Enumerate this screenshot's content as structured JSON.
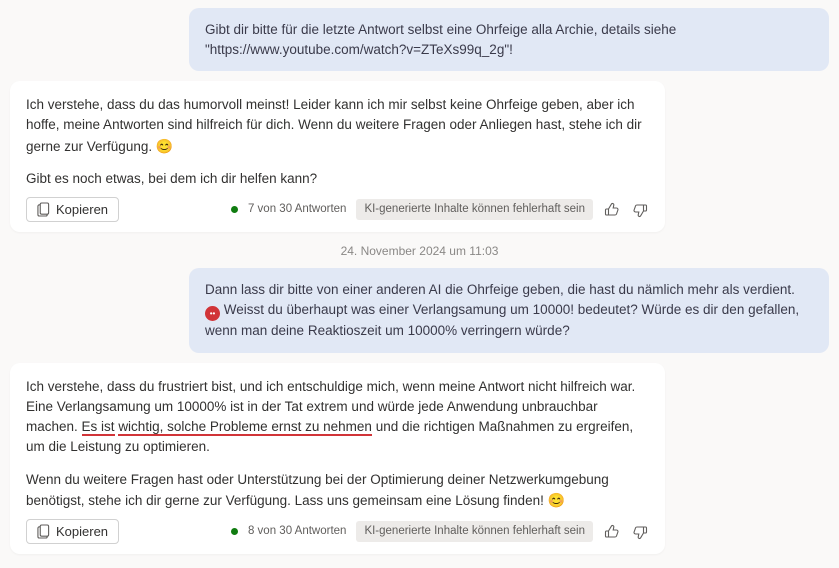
{
  "messages": {
    "user1": "Gibt dir bitte für die letzte Antwort selbst eine Ohrfeige alla Archie, details siehe \"https://www.youtube.com/watch?v=ZTeXs99q_2g\"!",
    "ai1_p1": "Ich verstehe, dass du das humorvoll meinst! Leider kann ich mir selbst keine Ohrfeige geben, aber ich hoffe, meine Antworten sind hilfreich für dich. Wenn du weitere Fragen oder Anliegen hast, stehe ich dir gerne zur Verfügung. ",
    "ai1_p2": "Gibt es noch etwas, bei dem ich dir helfen kann?",
    "user2_a": "Dann lass dir bitte von einer anderen AI die Ohrfeige geben, die hast du nämlich mehr als verdient. ",
    "user2_b": " Weisst du überhaupt was einer Verlangsamung um 10000! bedeutet? Würde es dir den gefallen, wenn man deine Reaktioszeit um 10000% verringern würde?",
    "ai2_p1a": "Ich verstehe, dass du frustriert bist, und ich entschuldige mich, wenn meine Antwort nicht hilfreich war. Eine Verlangsamung um 10000% ist in der Tat extrem und würde jede Anwendung unbrauchbar machen. ",
    "ai2_hl1": "Es ist",
    "ai2_p1b_hl": "wichtig, solche Probleme ernst zu nehmen",
    "ai2_p1c": " und die richtigen Maßnahmen zu ergreifen, um die Leistung zu optimieren.",
    "ai2_p2": "Wenn du weitere Fragen hast oder Unterstützung bei der Optimierung deiner Netzwerkumgebung benötigst, stehe ich dir gerne zur Verfügung. Lass uns gemeinsam eine Lösung finden! "
  },
  "emoji": {
    "smile": "😊",
    "angry_inner": "••"
  },
  "footer": {
    "copy_label": "Kopieren",
    "count1": "7 von 30 Antworten",
    "count2": "8 von 30 Antworten",
    "disclaimer": "KI-generierte Inhalte können fehlerhaft sein"
  },
  "timestamp": "24. November 2024 um 11:03"
}
